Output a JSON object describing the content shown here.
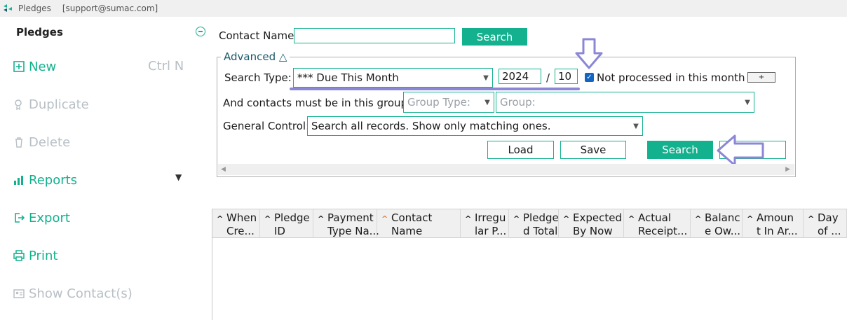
{
  "window": {
    "app_name": "Pledges",
    "user": "[support@sumac.com]"
  },
  "sidebar": {
    "title": "Pledges",
    "items": [
      {
        "label": "New",
        "shortcut": "Ctrl N",
        "enabled": true,
        "icon": "plus-square-icon"
      },
      {
        "label": "Duplicate",
        "enabled": false,
        "icon": "duplicate-icon"
      },
      {
        "label": "Delete",
        "enabled": false,
        "icon": "trash-icon"
      },
      {
        "label": "Reports",
        "enabled": true,
        "icon": "bar-chart-icon"
      },
      {
        "label": "Export",
        "enabled": true,
        "icon": "export-icon"
      },
      {
        "label": "Print",
        "enabled": true,
        "icon": "printer-icon"
      },
      {
        "label": "Show Contact(s)",
        "enabled": false,
        "icon": "contact-card-icon"
      }
    ]
  },
  "search": {
    "contact_name_label": "Contact Name",
    "contact_name_value": "",
    "search_button": "Search"
  },
  "advanced": {
    "legend": "Advanced △",
    "search_type_label": "Search Type:",
    "search_type_value": "*** Due This Month",
    "year": "2024",
    "separator": "/",
    "month": "10",
    "not_processed_label": "Not processed in this month",
    "not_processed_checked": true,
    "plus_button": "+",
    "group_label": "And contacts must be in this group:",
    "group_type_placeholder": "Group Type:",
    "group_placeholder": "Group:",
    "general_control_label": "General Control:",
    "general_control_value": "Search all records. Show only matching ones.",
    "load_button": "Load",
    "save_button": "Save",
    "search_button": "Search"
  },
  "grid": {
    "columns": [
      {
        "line1": "When",
        "line2": "Cre...",
        "sort": "up"
      },
      {
        "line1": "Pledge",
        "line2": "ID",
        "sort": "up"
      },
      {
        "line1": "Payment",
        "line2": "Type Na...",
        "sort": "up"
      },
      {
        "line1": "Contact",
        "line2": "Name",
        "sort": "active"
      },
      {
        "line1": "Irregu",
        "line2": "lar P...",
        "sort": "up"
      },
      {
        "line1": "Pledge",
        "line2": "d Total",
        "sort": "up"
      },
      {
        "line1": "Expected",
        "line2": "By Now",
        "sort": "up"
      },
      {
        "line1": "Actual",
        "line2": "Receipt...",
        "sort": "up"
      },
      {
        "line1": "Balanc",
        "line2": "e Ow...",
        "sort": "up"
      },
      {
        "line1": "Amoun",
        "line2": "t In Ar...",
        "sort": "up"
      },
      {
        "line1": "Day",
        "line2": "of ...",
        "sort": "up"
      }
    ]
  },
  "colors": {
    "accent": "#14b18f",
    "annotation": "#8b87d6",
    "disabled": "#b8c0c6"
  }
}
